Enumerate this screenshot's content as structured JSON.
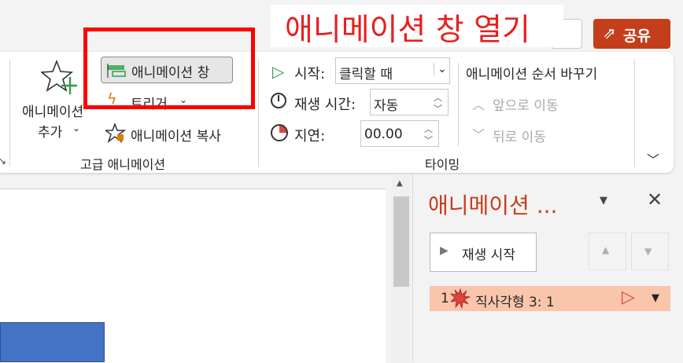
{
  "annotation": {
    "label": "애니메이션 창 열기"
  },
  "topbar": {
    "share_label": "공유"
  },
  "ribbon": {
    "add_animation_label_line1": "애니메이션",
    "add_animation_label_line2": "추가",
    "animation_pane_label": "애니메이션 창",
    "trigger_label": "트리거",
    "animation_painter_label": "애니메이션 복사",
    "advanced_group_label": "고급 애니메이션",
    "start_label": "시작:",
    "start_value": "클릭할 때",
    "duration_label": "재생 시간:",
    "duration_value": "자동",
    "delay_label": "지연:",
    "delay_value": "00.00",
    "reorder_label": "애니메이션 순서 바꾸기",
    "move_earlier_label": "앞으로 이동",
    "move_later_label": "뒤로 이동",
    "timing_group_label": "타이밍"
  },
  "pane": {
    "title": "애니메이션 ...",
    "play_label": "재생 시작",
    "items": [
      {
        "number": "1",
        "name": "직사각형 3: 1"
      }
    ]
  },
  "colors": {
    "annotation_red": "#ff0000",
    "share_button": "#c43e1c",
    "pane_title": "#c43e1c",
    "selected_row": "#f9c6ac",
    "shape_fill": "#4472c4",
    "play_icon_green": "#2e9d47"
  }
}
